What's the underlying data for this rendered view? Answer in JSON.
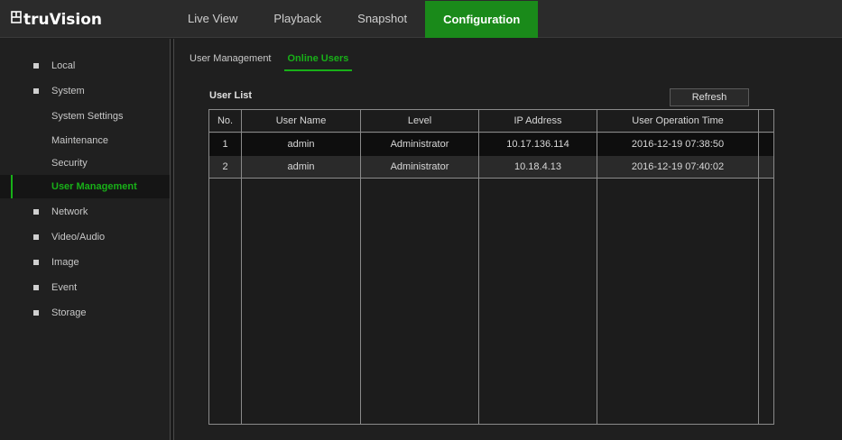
{
  "app": {
    "brand": "truVision"
  },
  "topnav": {
    "items": [
      {
        "label": "Live View"
      },
      {
        "label": "Playback"
      },
      {
        "label": "Snapshot"
      },
      {
        "label": "Configuration"
      }
    ],
    "active": "Configuration"
  },
  "sidebar": {
    "items": [
      {
        "label": "Local",
        "type": "group"
      },
      {
        "label": "System",
        "type": "group"
      },
      {
        "label": "System Settings",
        "type": "sub"
      },
      {
        "label": "Maintenance",
        "type": "sub"
      },
      {
        "label": "Security",
        "type": "sub"
      },
      {
        "label": "User Management",
        "type": "sub",
        "active": true
      },
      {
        "label": "Network",
        "type": "group"
      },
      {
        "label": "Video/Audio",
        "type": "group"
      },
      {
        "label": "Image",
        "type": "group"
      },
      {
        "label": "Event",
        "type": "group"
      },
      {
        "label": "Storage",
        "type": "group"
      }
    ]
  },
  "subtabs": {
    "items": [
      {
        "label": "User Management"
      },
      {
        "label": "Online Users"
      }
    ],
    "active": "Online Users"
  },
  "user_list": {
    "title": "User List",
    "refresh_label": "Refresh",
    "columns": [
      "No.",
      "User Name",
      "Level",
      "IP Address",
      "User Operation Time"
    ],
    "rows": [
      [
        "1",
        "admin",
        "Administrator",
        "10.17.136.114",
        "2016-12-19 07:38:50"
      ],
      [
        "2",
        "admin",
        "Administrator",
        "10.18.4.13",
        "2016-12-19 07:40:02"
      ]
    ]
  },
  "colors": {
    "accent": "#1a8a1a",
    "accent_text": "#18b018",
    "background": "#1f1f1f"
  }
}
